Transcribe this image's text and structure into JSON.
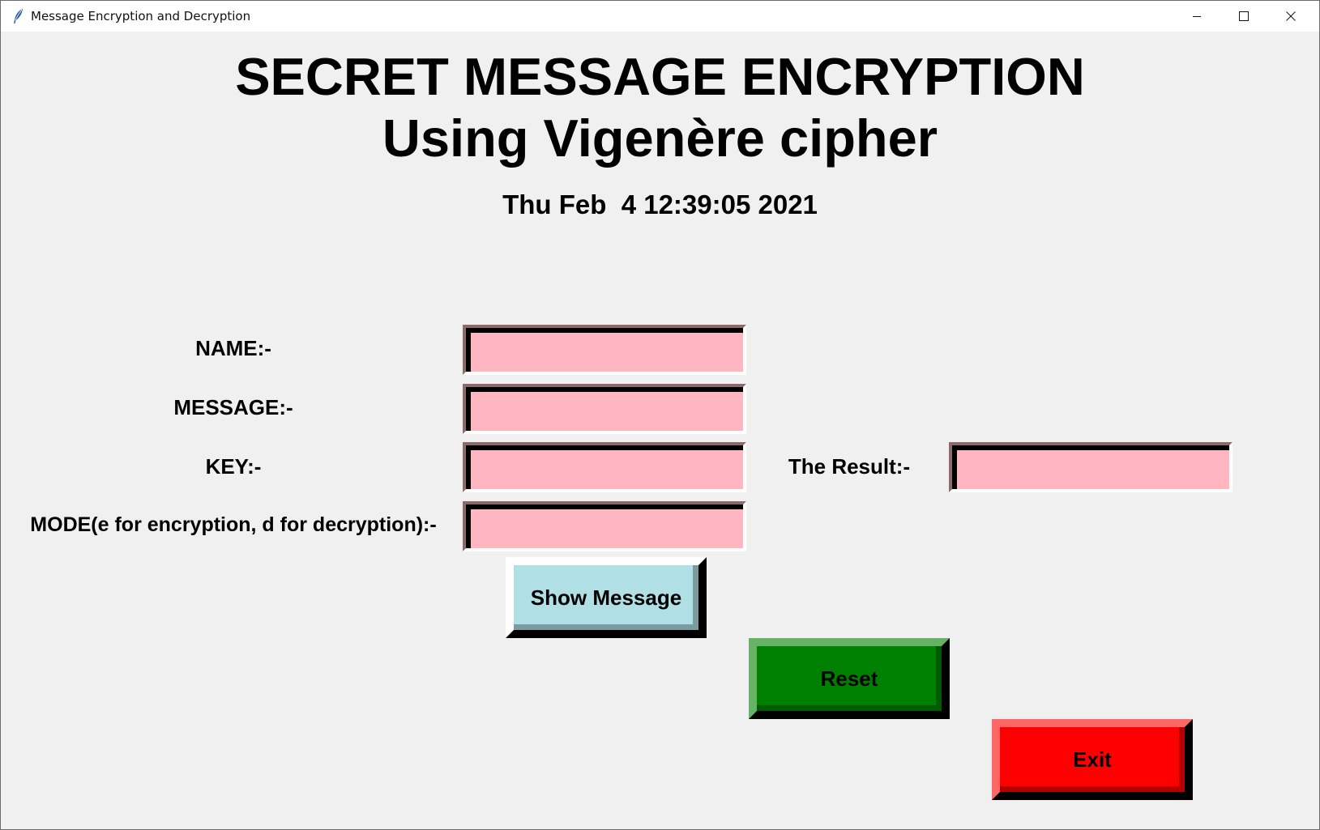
{
  "window": {
    "title": "Message Encryption and Decryption",
    "controls": {
      "minimize_icon": "minimize-icon",
      "maximize_icon": "maximize-icon",
      "close_icon": "close-icon"
    }
  },
  "header": {
    "title_line1": "SECRET MESSAGE ENCRYPTION",
    "title_line2": "Using Vigenère cipher",
    "datetime": "Thu Feb  4 12:39:05 2021"
  },
  "form": {
    "name_label": "NAME:-",
    "name_value": "",
    "message_label": "MESSAGE:-",
    "message_value": "",
    "key_label": "KEY:-",
    "key_value": "",
    "mode_label": "MODE(e for encryption, d for decryption):-",
    "mode_value": "",
    "result_label": "The Result:-",
    "result_value": ""
  },
  "buttons": {
    "show_message": "Show Message",
    "reset": "Reset",
    "exit": "Exit"
  },
  "colors": {
    "entry_bg": "#ffb6c1",
    "show_button_bg": "#b0e0e6",
    "reset_button_bg": "#008000",
    "exit_button_bg": "#ff0000",
    "window_bg": "#f0f0f0"
  }
}
